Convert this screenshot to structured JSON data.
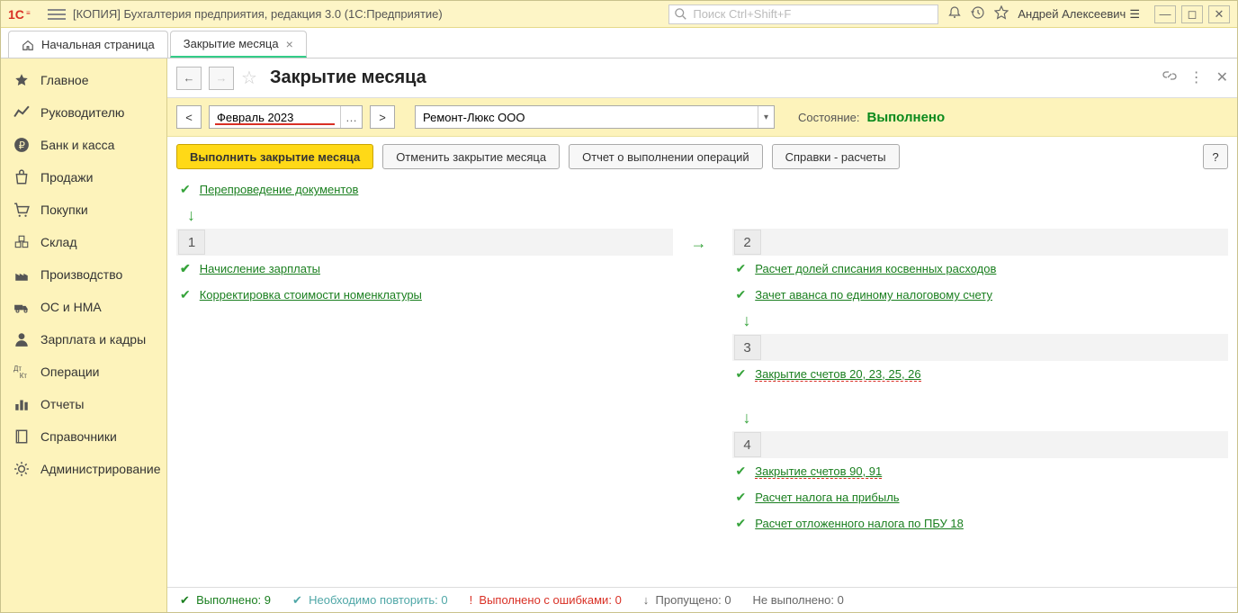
{
  "titlebar": {
    "title": "[КОПИЯ] Бухгалтерия предприятия, редакция 3.0  (1С:Предприятие)",
    "search_placeholder": "Поиск Ctrl+Shift+F",
    "user": "Андрей Алексеевич"
  },
  "tabs": {
    "home": "Начальная страница",
    "active": "Закрытие месяца"
  },
  "sidebar": {
    "items": [
      "Главное",
      "Руководителю",
      "Банк и касса",
      "Продажи",
      "Покупки",
      "Склад",
      "Производство",
      "ОС и НМА",
      "Зарплата и кадры",
      "Операции",
      "Отчеты",
      "Справочники",
      "Администрирование"
    ]
  },
  "page": {
    "title": "Закрытие месяца",
    "period": "Февраль 2023",
    "org": "Ремонт-Люкс ООО",
    "state_label": "Состояние:",
    "state_value": "Выполнено"
  },
  "toolbar": {
    "execute": "Выполнить закрытие месяца",
    "cancel": "Отменить закрытие месяца",
    "report": "Отчет о выполнении операций",
    "refs": "Справки - расчеты",
    "help": "?"
  },
  "ops": {
    "reprocess": "Перепроведение документов",
    "stage1": [
      "Начисление зарплаты",
      "Корректировка стоимости номенклатуры"
    ],
    "stage2": [
      "Расчет долей списания косвенных расходов",
      "Зачет аванса по единому налоговому счету"
    ],
    "stage3": [
      "Закрытие счетов 20, 23, 25, 26"
    ],
    "stage4": [
      "Закрытие счетов 90, 91",
      "Расчет налога на прибыль",
      "Расчет отложенного налога по ПБУ 18"
    ]
  },
  "status": {
    "done_label": "Выполнено:",
    "done_count": "9",
    "repeat_label": "Необходимо повторить:",
    "repeat_count": "0",
    "errors_label": "Выполнено с ошибками:",
    "errors_count": "0",
    "skipped_label": "Пропущено:",
    "skipped_count": "0",
    "notdone_label": "Не выполнено:",
    "notdone_count": "0"
  }
}
